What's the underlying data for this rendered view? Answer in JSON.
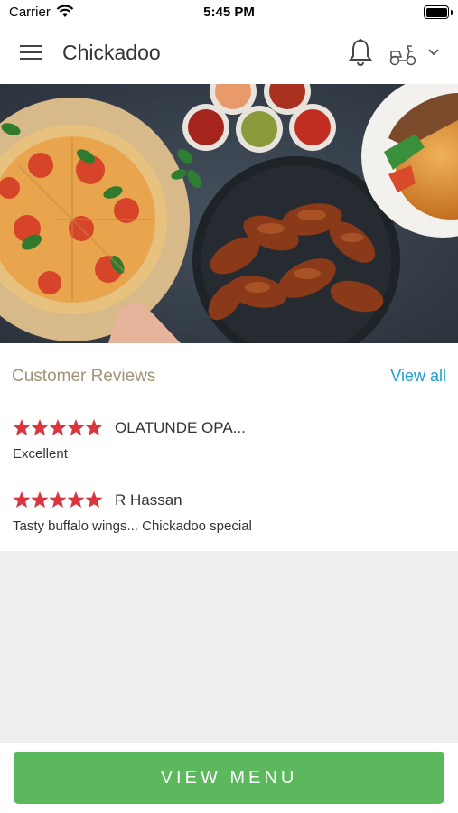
{
  "status_bar": {
    "carrier": "Carrier",
    "time": "5:45 PM"
  },
  "header": {
    "title": "Chickadoo"
  },
  "icons": {
    "menu": "hamburger-menu-icon",
    "notifications": "bell-icon",
    "delivery": "scooter-icon",
    "expand": "chevron-down-icon"
  },
  "reviews": {
    "title": "Customer Reviews",
    "view_all": "View all",
    "star_color": "#d9363e",
    "items": [
      {
        "name": "OLATUNDE OPA...",
        "rating": 5,
        "text": "Excellent"
      },
      {
        "name": "R Hassan",
        "rating": 5,
        "text": "Tasty buffalo wings... Chickadoo special"
      }
    ]
  },
  "footer": {
    "button_label": "VIEW MENU",
    "button_color": "#5cb85c"
  }
}
